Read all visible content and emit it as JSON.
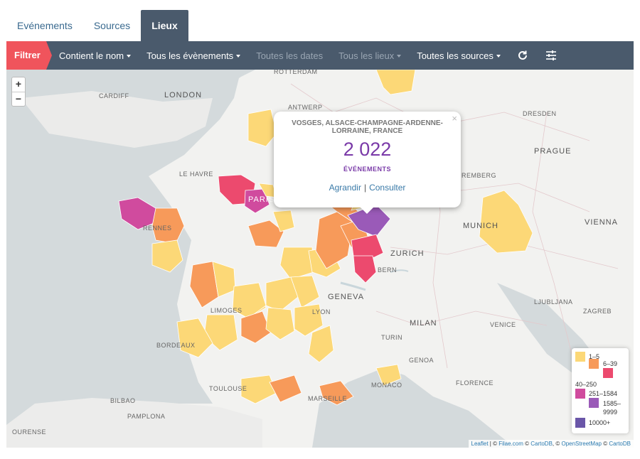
{
  "tabs": [
    {
      "label": "Evénements",
      "active": false
    },
    {
      "label": "Sources",
      "active": false
    },
    {
      "label": "Lieux",
      "active": true
    }
  ],
  "toolbar": {
    "filter_label": "Filtrer",
    "items": [
      {
        "label": "Contient le nom",
        "dropdown": true,
        "enabled": true
      },
      {
        "label": "Tous les évènements",
        "dropdown": true,
        "enabled": true
      },
      {
        "label": "Toutes les dates",
        "dropdown": false,
        "enabled": false
      },
      {
        "label": "Tous les lieux",
        "dropdown": true,
        "enabled": false
      },
      {
        "label": "Toutes les sources",
        "dropdown": true,
        "enabled": true
      }
    ],
    "icons": [
      "refresh-icon",
      "sliders-icon"
    ]
  },
  "map": {
    "zoom_in": "+",
    "zoom_out": "−",
    "cities": [
      "ROTTERDAM",
      "ANTWERP",
      "CARDIFF",
      "LONDON",
      "LE HAVRE",
      "PARIS",
      "RENNES",
      "DRESDEN",
      "PRAGUE",
      "NUREMBERG",
      "MUNICH",
      "VIENNA",
      "ZURICH",
      "BERN",
      "GENEVA",
      "LIMOGES",
      "LYON",
      "LJUBLJANA",
      "ZAGREB",
      "MILAN",
      "VENICE",
      "BORDEAUX",
      "TURIN",
      "GENOA",
      "MONACO",
      "FLORENCE",
      "TOULOUSE",
      "MARSEILLE",
      "BILBAO",
      "PAMPLONA",
      "OURENSE"
    ],
    "popup": {
      "place": "VOSGES, ALSACE-CHAMPAGNE-ARDENNE-LORRAINE, FRANCE",
      "count": "2 022",
      "unit": "ÉVÉNEMENTS",
      "link_zoom": "Agrandir",
      "separator": "|",
      "link_view": "Consulter",
      "close": "×"
    },
    "legend": [
      {
        "label": "1–5",
        "color": "#fcd877"
      },
      {
        "label": "6–39",
        "color": "#f79a5a"
      },
      {
        "label": "40–250",
        "color": "#ec4a6e"
      },
      {
        "label": "251–1584",
        "color": "#d04b9e"
      },
      {
        "label": "1585–9999",
        "color": "#9a5ab8"
      },
      {
        "label": "10000+",
        "color": "#6a56a8"
      }
    ],
    "attribution": {
      "leaflet": "Leaflet",
      "sep1": " | © ",
      "filae": "Filae.com",
      "sep2": " © ",
      "cartodb1": "CartoDB",
      "sep3": ", © ",
      "osm": "OpenStreetMap",
      "sep4": " © ",
      "cartodb2": "CartoDB"
    }
  }
}
